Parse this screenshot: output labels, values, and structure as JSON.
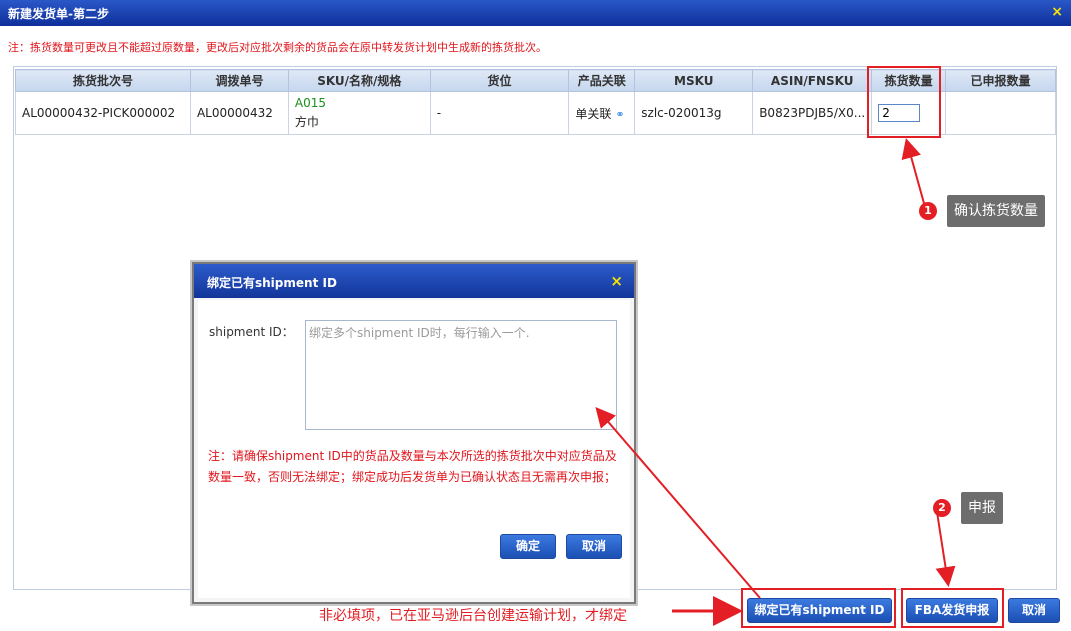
{
  "window": {
    "title": "新建发货单-第二步",
    "close_icon": "×"
  },
  "note": "注：拣货数量可更改且不能超过原数量，更改后对应批次剩余的货品会在原中转发货计划中生成新的拣货批次。",
  "table": {
    "headers": [
      "拣货批次号",
      "调拨单号",
      "SKU/名称/规格",
      "货位",
      "产品关联",
      "MSKU",
      "ASIN/FNSKU",
      "拣货数量",
      "已申报数量"
    ],
    "row": {
      "batch_no": "AL00000432-PICK000002",
      "transfer_no": "AL00000432",
      "sku_code": "A015",
      "sku_name": "方巾",
      "location": "-",
      "relation": "单关联",
      "msku": "szlc-020013g",
      "asin": "B0823PDJB5/X0...",
      "qty": "2",
      "declared": ""
    }
  },
  "dialog": {
    "title": "绑定已有shipment ID",
    "close_icon": "×",
    "field_label": "shipment ID：",
    "placeholder": "绑定多个shipment ID时，每行输入一个.",
    "note": "注：请确保shipment ID中的货品及数量与本次所选的拣货批次中对应货品及数量一致，否则无法绑定；绑定成功后发货单为已确认状态且无需再次申报；",
    "ok": "确定",
    "cancel": "取消"
  },
  "footer": {
    "bind_button": "绑定已有shipment ID",
    "fba_button": "FBA发货申报",
    "cancel_button": "取消"
  },
  "annotations": {
    "step1_num": "1",
    "step1_text": "确认拣货数量",
    "step2_num": "2",
    "step2_text": "申报",
    "optional_text": "非必填项，已在亚马逊后台创建运输计划，才绑定"
  }
}
